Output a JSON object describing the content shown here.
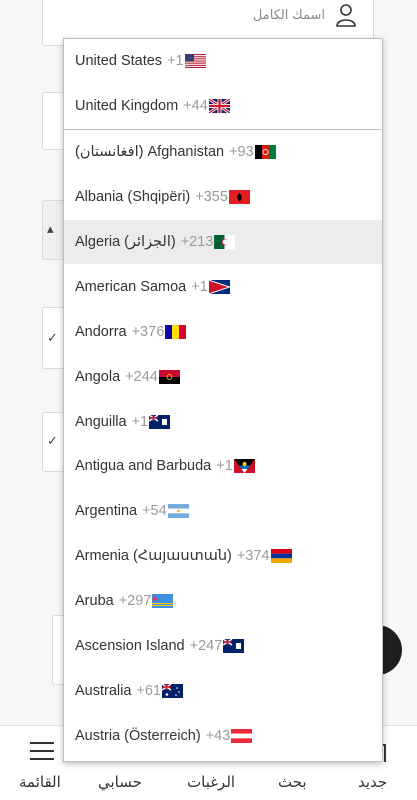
{
  "form": {
    "name_placeholder": "اسمك الكامل"
  },
  "dropdown": {
    "preferred": [
      {
        "name": "United States",
        "dial": "+1",
        "flag": "us"
      },
      {
        "name": "United Kingdom",
        "dial": "+44",
        "flag": "gb"
      }
    ],
    "countries": [
      {
        "name": "(افغانستان Afghanistan",
        "dial": "+93",
        "flag": "af",
        "display": "(افغانستان) Afghanistan"
      },
      {
        "name": "Albania (Shqipëri)",
        "dial": "+355",
        "flag": "al"
      },
      {
        "name": "Algeria (الجزائر)",
        "dial": "+213",
        "flag": "dz",
        "highlighted": true
      },
      {
        "name": "American Samoa",
        "dial": "+1",
        "flag": "as"
      },
      {
        "name": "Andorra",
        "dial": "+376",
        "flag": "ad"
      },
      {
        "name": "Angola",
        "dial": "+244",
        "flag": "ao"
      },
      {
        "name": "Anguilla",
        "dial": "+1",
        "flag": "ai"
      },
      {
        "name": "Antigua and Barbuda",
        "dial": "+1",
        "flag": "ag"
      },
      {
        "name": "Argentina",
        "dial": "+54",
        "flag": "ar"
      },
      {
        "name": "Armenia (Հայաստան)",
        "dial": "+374",
        "flag": "am"
      },
      {
        "name": "Aruba",
        "dial": "+297",
        "flag": "aw"
      },
      {
        "name": "Ascension Island",
        "dial": "+247",
        "flag": "ac"
      },
      {
        "name": "Australia",
        "dial": "+61",
        "flag": "au"
      },
      {
        "name": "Austria (Österreich)",
        "dial": "+43",
        "flag": "at"
      }
    ]
  },
  "bottom_nav": {
    "menu": "القائمة",
    "account": "حسابي",
    "wishes": "الرغبات",
    "search": "بحث",
    "new": "جديد"
  }
}
